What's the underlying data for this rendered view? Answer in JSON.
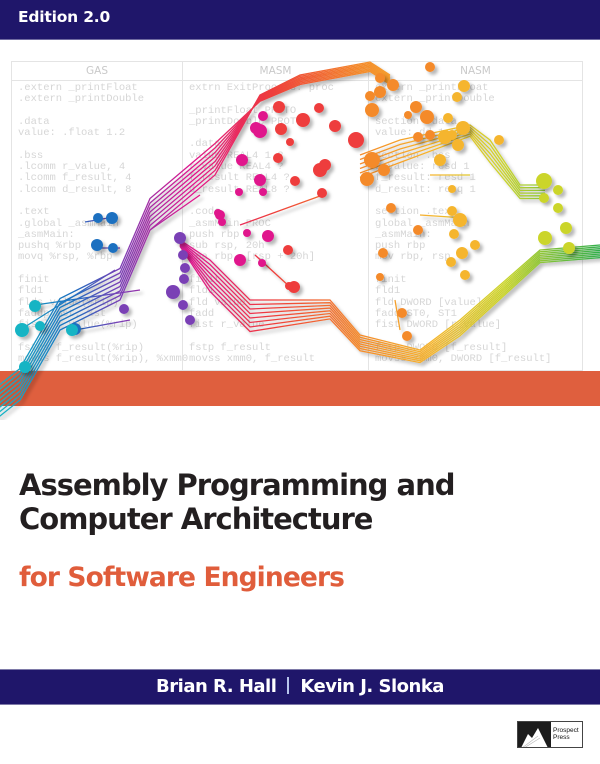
{
  "header": {
    "edition": "Edition 2.0"
  },
  "code_panel": {
    "columns": [
      {
        "name": "GAS",
        "lines": [
          ".extern _printFloat",
          ".extern _printDouble",
          "",
          ".data",
          "value: .float 1.2",
          "",
          ".bss",
          ".lcomm r_value, 4",
          ".lcomm f_result, 4",
          ".lcomm d_result, 8",
          "",
          ".text",
          ".global _asmMain",
          "_asmMain:",
          "pushq %rbp",
          "movq %rsp, %rbp",
          "",
          "finit",
          "fld1",
          "flds value(%rip)",
          "faddp %st, %st",
          "fistl r_value(%rip)",
          "",
          "fstps f_result(%rip)",
          "movss f_result(%rip), %xmm0"
        ]
      },
      {
        "name": "MASM",
        "lines": [
          "extrn ExitProcess: proc",
          "",
          "_printFloat PROTO",
          "_printDouble PROTO",
          "",
          ".data",
          "value REAL4 1.2",
          "r_value REAL4 ?",
          "f_result REAL4 ?",
          "d_result REAL8 ?",
          "",
          ".code",
          "_asmMain PROC",
          "push rbp",
          "sub rsp, 20h",
          "lea rbp, [rsp + 20h]",
          "",
          "finit",
          "fld1",
          "fld value",
          "fadd",
          "fist r_value",
          "",
          "fstp f_result",
          "movss xmm0, f_result"
        ]
      },
      {
        "name": "NASM",
        "lines": [
          "extern _printFloat",
          "extern _printDouble",
          "",
          "section .data",
          "value: dd 1.2",
          "",
          "section .bss",
          "r_value: resd 1",
          "f_result: resd 1",
          "d_result: resq 1",
          "",
          "section .text",
          "global _asmMain",
          "_asmMain:",
          "push rbp",
          "mov rbp, rsp",
          "",
          "finit",
          "fld1",
          "fld DWORD [value]",
          "fadd ST0, ST1",
          "fist DWORD [r_value]",
          "",
          "fstp DWORD [f_result]",
          "movss xmm0, DWORD [f_result]"
        ]
      }
    ]
  },
  "title": {
    "line1": "Assembly Programming and",
    "line2": "Computer Architecture",
    "subtitle": "for Software Engineers"
  },
  "authors": {
    "first": "Brian R. Hall",
    "second": "Kevin J. Slonka"
  },
  "publisher": {
    "line1": "Prospect",
    "line2": "Press",
    "icon": "mountain-logo-icon"
  },
  "colors": {
    "navy": "#1f166a",
    "orange": "#df5f3e",
    "title_text": "#231f20",
    "gradient": [
      "#18b4c4",
      "#1b6fc0",
      "#7a3fb5",
      "#e0168c",
      "#ee3c3c",
      "#f48a2a",
      "#f5b52e",
      "#cbd52a",
      "#4cb848"
    ]
  }
}
